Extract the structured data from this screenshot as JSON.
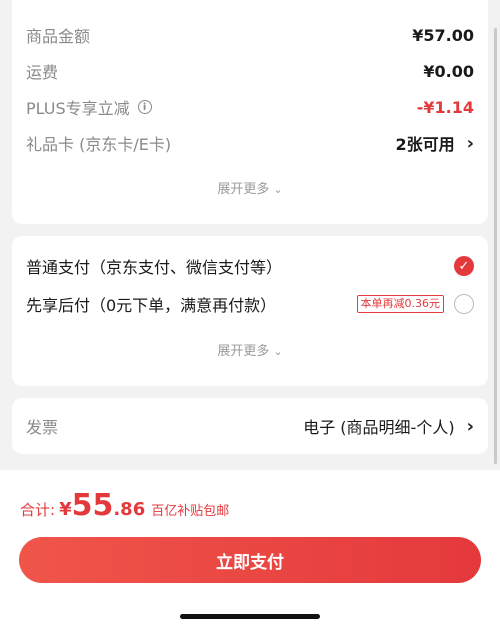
{
  "summary": {
    "goods_amount_label": "商品金额",
    "goods_amount_value": "¥57.00",
    "shipping_label": "运费",
    "shipping_value": "¥0.00",
    "plus_label": "PLUS专享立减",
    "plus_info_icon": "i",
    "plus_value": "-¥1.14",
    "giftcard_label": "礼品卡 (京东卡/E卡)",
    "giftcard_value": "2张可用",
    "chevron": "›",
    "expand_label": "展开更多",
    "expand_caret": "⌄"
  },
  "payment": {
    "standard_label": "普通支付（京东支付、微信支付等）",
    "standard_selected": true,
    "check_glyph": "✓",
    "later_label": "先享后付（0元下单，满意再付款）",
    "later_tag": "本单再减0.36元",
    "later_selected": false,
    "expand_label": "展开更多",
    "expand_caret": "⌄"
  },
  "invoice": {
    "label": "发票",
    "value": "电子 (商品明细-个人)",
    "chevron": "›"
  },
  "footer": {
    "total_label": "合计:",
    "currency": "¥",
    "total_integer": "55",
    "total_decimal": ".86",
    "note": "百亿补贴包邮",
    "pay_button": "立即支付"
  },
  "colors": {
    "accent": "#e4393c",
    "background": "#f2f2f2"
  }
}
